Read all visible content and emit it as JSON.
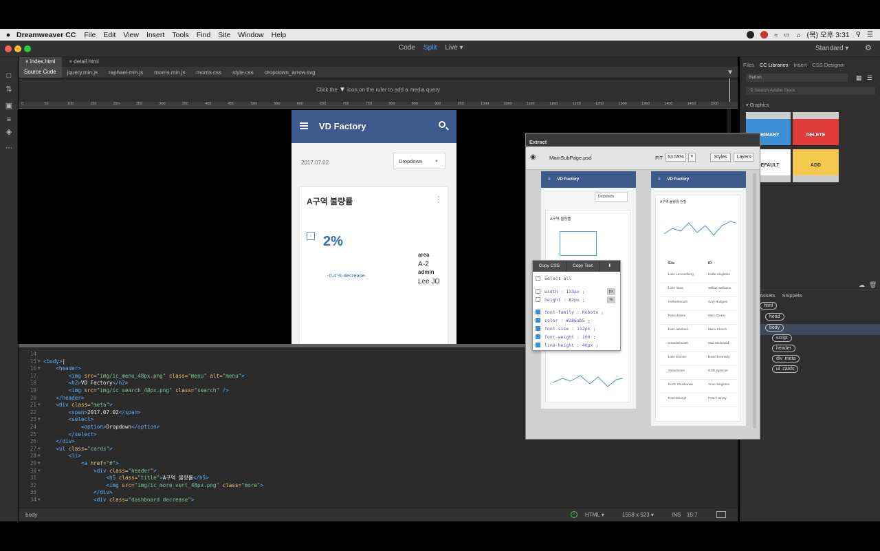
{
  "menubar": {
    "app_name": "Dreamweaver CC",
    "items": [
      "File",
      "Edit",
      "View",
      "Insert",
      "Tools",
      "Find",
      "Site",
      "Window",
      "Help"
    ],
    "clock": "(목) 오후 3:31"
  },
  "titlebar": {
    "view_modes": [
      "Code",
      "Split",
      "Live"
    ],
    "active_view": "Split",
    "workspace": "Standard"
  },
  "doc_tabs": [
    "index.html",
    "detail.html"
  ],
  "related_files": [
    "Source Code",
    "jquery.min.js",
    "raphael-min.js",
    "morris.min.js",
    "morris.css",
    "style.css",
    "dropdown_arrow.svg"
  ],
  "media_query_hint": {
    "before": "Click the",
    "after": "icon on the ruler to add a media query"
  },
  "ruler_ticks": [
    "0",
    "50",
    "100",
    "150",
    "200",
    "250",
    "300",
    "350",
    "400",
    "450",
    "500",
    "550",
    "600",
    "650",
    "700",
    "750",
    "800",
    "850",
    "900",
    "950",
    "1000",
    "1050",
    "1100",
    "1150",
    "1200",
    "1250",
    "1300",
    "1350",
    "1400",
    "1450",
    "1500"
  ],
  "mobile": {
    "title": "VD Factory",
    "date": "2017.07.02",
    "dropdown": "Dropdown",
    "card_title": "A구역 불량률",
    "value": "2%",
    "change": "-0.4 % decrease",
    "area_label": "area",
    "area_value": "A-2",
    "admin_label": "admin",
    "admin_value": "Lee JD",
    "header_color": "#3c5a8c",
    "value_color": "#2f6fb5"
  },
  "code_lines": [
    {
      "n": "14",
      "fold": "",
      "html": ""
    },
    {
      "n": "15",
      "fold": "▼",
      "html": "<span class='tg'>&lt;body&gt;</span>|"
    },
    {
      "n": "16",
      "fold": "▼",
      "html": "    <span class='tg'>&lt;header&gt;</span>"
    },
    {
      "n": "17",
      "fold": "",
      "html": "        <span class='tg'>&lt;img</span> <span class='at'>src=</span><span class='st'>\"img/ic_menu_48px.png\"</span> <span class='at'>class=</span><span class='st'>\"menu\"</span> <span class='at'>alt=</span><span class='st'>\"menu\"</span><span class='tg'>&gt;</span>"
    },
    {
      "n": "18",
      "fold": "",
      "html": "        <span class='tg'>&lt;h2&gt;</span>VD Factory<span class='tg'>&lt;/h2&gt;</span>"
    },
    {
      "n": "19",
      "fold": "",
      "html": "        <span class='tg'>&lt;img</span> <span class='at'>src=</span><span class='st'>\"img/ic_search_48px.png\"</span> <span class='at'>class=</span><span class='st'>\"search\"</span> <span class='tg'>/&gt;</span>"
    },
    {
      "n": "20",
      "fold": "",
      "html": "    <span class='tg'>&lt;/header&gt;</span>"
    },
    {
      "n": "21",
      "fold": "▼",
      "html": "    <span class='tg'>&lt;div</span> <span class='at'>class=</span><span class='st'>\"meta\"</span><span class='tg'>&gt;</span>"
    },
    {
      "n": "22",
      "fold": "",
      "html": "        <span class='tg'>&lt;span&gt;</span>2017.07.02<span class='tg'>&lt;/span&gt;</span>"
    },
    {
      "n": "23",
      "fold": "▼",
      "html": "        <span class='tg'>&lt;select&gt;</span>"
    },
    {
      "n": "24",
      "fold": "",
      "html": "            <span class='tg'>&lt;option&gt;</span>Dropdown<span class='tg'>&lt;/option&gt;</span>"
    },
    {
      "n": "25",
      "fold": "",
      "html": "        <span class='tg'>&lt;/select&gt;</span>"
    },
    {
      "n": "26",
      "fold": "",
      "html": "    <span class='tg'>&lt;/div&gt;</span>"
    },
    {
      "n": "27",
      "fold": "▼",
      "html": "    <span class='tg'>&lt;ul</span> <span class='at'>class=</span><span class='st'>\"cards\"</span><span class='tg'>&gt;</span>"
    },
    {
      "n": "28",
      "fold": "▼",
      "html": "        <span class='tg'>&lt;li&gt;</span>"
    },
    {
      "n": "29",
      "fold": "▼",
      "html": "            <span class='tg'>&lt;a</span> <span class='at'>href=</span><span class='st'>\"#\"</span><span class='tg'>&gt;</span>"
    },
    {
      "n": "30",
      "fold": "▼",
      "html": "                <span class='tg'>&lt;div</span> <span class='at'>class=</span><span class='st'>\"header\"</span><span class='tg'>&gt;</span>"
    },
    {
      "n": "31",
      "fold": "",
      "html": "                    <span class='tg'>&lt;h5</span> <span class='at'>class=</span><span class='st'>\"title\"</span><span class='tg'>&gt;</span>A구역 불량률<span class='tg'>&lt;/h5&gt;</span>"
    },
    {
      "n": "32",
      "fold": "",
      "html": "                    <span class='tg'>&lt;img</span> <span class='at'>src=</span><span class='st'>\"img/ic_more_vert_48px.png\"</span> <span class='at'>class=</span><span class='st'>\"more\"</span><span class='tg'>&gt;</span>"
    },
    {
      "n": "33",
      "fold": "",
      "html": "                <span class='tg'>&lt;/div&gt;</span>"
    },
    {
      "n": "34",
      "fold": "▼",
      "html": "                <span class='tg'>&lt;div</span> <span class='at'>class=</span><span class='st'>\"dashboard decrease\"</span><span class='tg'>&gt;</span>"
    }
  ],
  "statusbar": {
    "tag": "body",
    "language": "HTML",
    "size": "1558 x 523",
    "mode": "INS",
    "position": "15:7"
  },
  "right_panel": {
    "tabs": [
      "Files",
      "CC Libraries",
      "Insert",
      "CSS Designer"
    ],
    "active_tab": "CC Libraries",
    "library": "Button",
    "search_placeholder": "Search Adobe Stock",
    "graphics_label": "Graphics",
    "swatches": [
      {
        "label": "PRIMARY",
        "color": "#3d8fd6"
      },
      {
        "label": "DELETE",
        "color": "#e03a3a"
      },
      {
        "label": "DEFAULT",
        "color": "#ffffff"
      },
      {
        "label": "ADD",
        "color": "#f2c94c"
      }
    ],
    "assets_tabs": [
      "Assets",
      "Snippets"
    ],
    "dom_nodes": [
      "html",
      "head",
      "body",
      "script",
      "header",
      "div .meta",
      "ul .cards"
    ]
  },
  "extract": {
    "title": "Extract",
    "file": "MainSubPage.psd",
    "fit_label": "FIT",
    "zoom": "53.59%",
    "styles_btn": "Styles",
    "layers_btn": "Layers",
    "artboard_title": "VD Factory",
    "artboard_left": {
      "dropdown": "Dropdown",
      "card_title": "A구역 불량률"
    },
    "artboard_right": {
      "card_title": "A구역 불량률 현황",
      "columns": [
        "Site",
        "ID"
      ],
      "rows": [
        [
          "Lake Leonnelberg",
          "Hallie Singleton"
        ],
        [
          "Lake Vena",
          "William Williams"
        ],
        [
          "Herbertmouth",
          "Cory Rodgers"
        ],
        [
          "Pascuhaven",
          "Marc Cores"
        ],
        [
          "East Jakeland",
          "Mario French"
        ],
        [
          "Grandelmouth",
          "Mae Mcdonald"
        ],
        [
          "Lake Emmet",
          "David Kennedy"
        ],
        [
          "Zulauhaven",
          "Edith Spencer"
        ],
        [
          "North Shushanan",
          "Anne Singleton"
        ],
        [
          "Raverkburgh",
          "Peter Harvey"
        ]
      ]
    }
  },
  "css_menu": {
    "tabs": [
      "Copy CSS",
      "Copy Text"
    ],
    "select_all": "Select all",
    "props": [
      {
        "text": "width : 133px ;",
        "checked": false
      },
      {
        "text": "height : 82px ;",
        "checked": false
      },
      {
        "text": "font-family : Roboto ;",
        "checked": true
      },
      {
        "text": "color : #286ab5 ;",
        "checked": true
      },
      {
        "text": "font-size : 112px ;",
        "checked": true
      },
      {
        "text": "font-weight : 100 ;",
        "checked": true
      },
      {
        "text": "line-height : 40px ;",
        "checked": true
      }
    ],
    "units": [
      "px",
      "%"
    ]
  }
}
